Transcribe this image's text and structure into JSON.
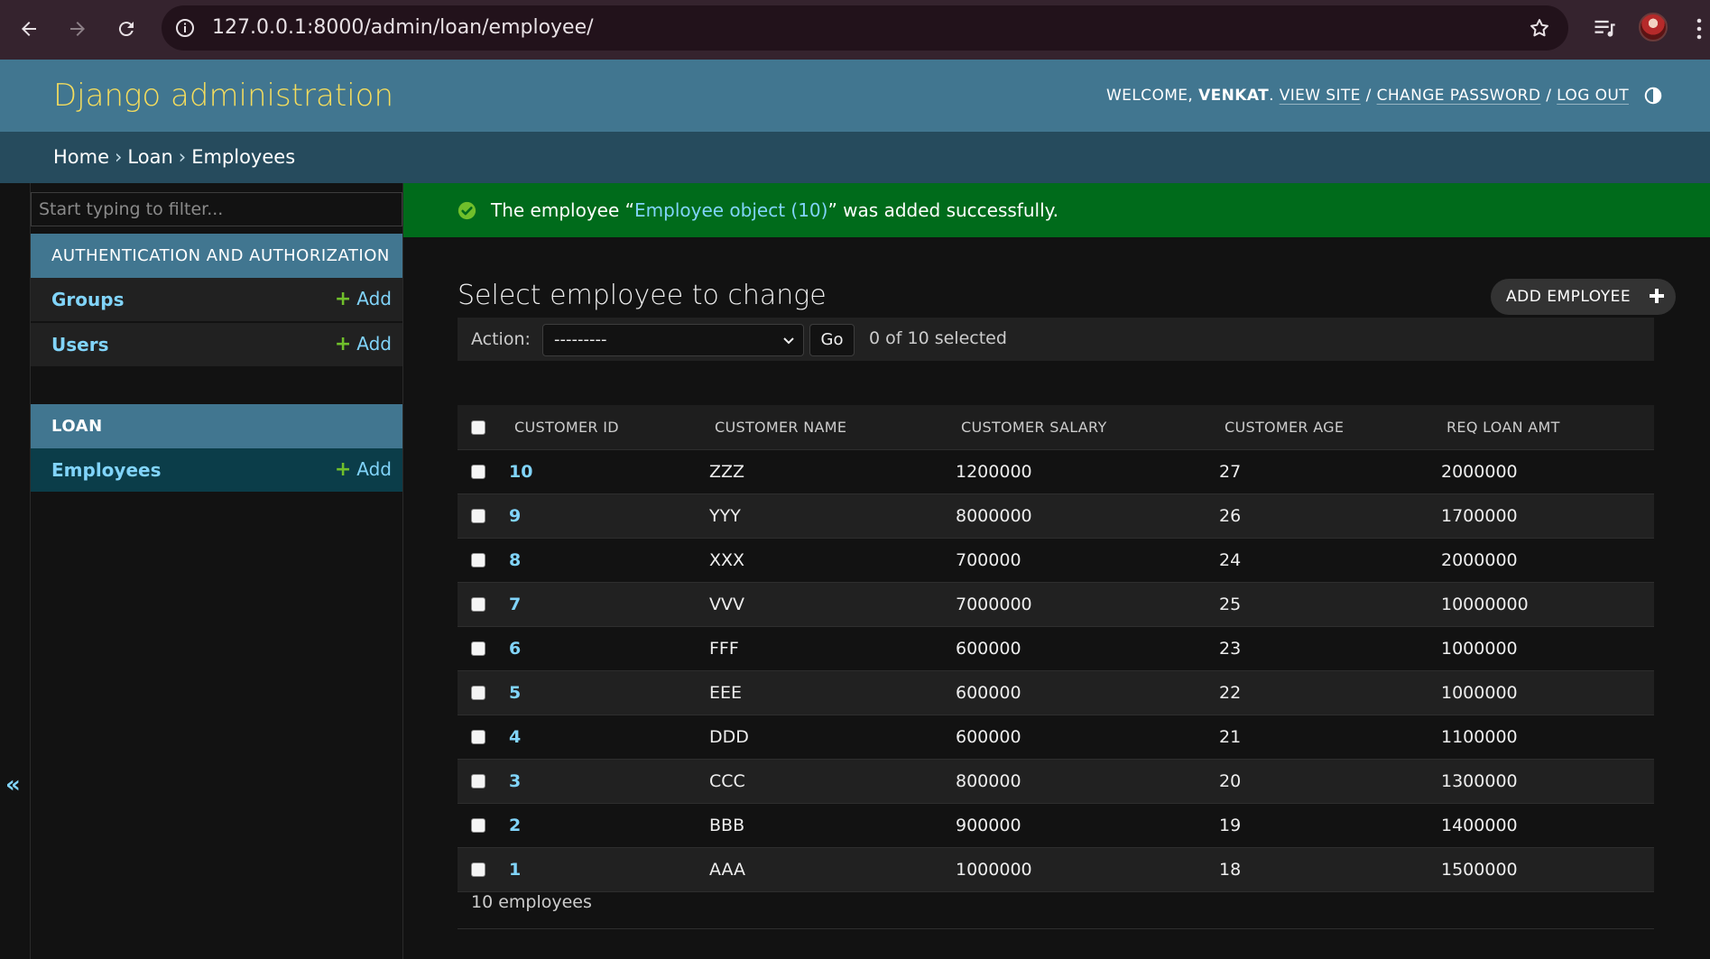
{
  "browser": {
    "url": "127.0.0.1:8000/admin/loan/employee/",
    "chrome_color": "#35232e"
  },
  "header": {
    "site_name": "Django administration",
    "welcome_prefix": "WELCOME,",
    "username": "VENKAT",
    "view_site": "VIEW SITE",
    "change_password": "CHANGE PASSWORD",
    "log_out": "LOG OUT",
    "separator": "/",
    "accent_color": "#f5dd5d"
  },
  "breadcrumbs": {
    "home": "Home",
    "app": "Loan",
    "model": "Employees",
    "separator": "›"
  },
  "sidebar": {
    "filter_placeholder": "Start typing to filter...",
    "collapse_label": "«",
    "modules": [
      {
        "caption": "AUTHENTICATION AND AUTHORIZATION",
        "models": [
          {
            "name": "Groups",
            "add": "Add"
          },
          {
            "name": "Users",
            "add": "Add"
          }
        ]
      },
      {
        "caption": "LOAN",
        "models": [
          {
            "name": "Employees",
            "add": "Add",
            "current": true
          }
        ]
      }
    ]
  },
  "messages": {
    "success_prefix": "The employee “",
    "success_link": "Employee object (10)",
    "success_suffix": "” was added successfully.",
    "success_color": "#006b1b"
  },
  "changelist": {
    "title": "Select employee to change",
    "add_button": "ADD EMPLOYEE",
    "action_label": "Action:",
    "action_selected": "---------",
    "go_button": "Go",
    "selection_counter": "0 of 10 selected",
    "columns": [
      "CUSTOMER ID",
      "CUSTOMER NAME",
      "CUSTOMER SALARY",
      "CUSTOMER AGE",
      "REQ LOAN AMT"
    ],
    "rows": [
      {
        "id": "10",
        "name": "ZZZ",
        "salary": "1200000",
        "age": "27",
        "loan": "2000000"
      },
      {
        "id": "9",
        "name": "YYY",
        "salary": "8000000",
        "age": "26",
        "loan": "1700000"
      },
      {
        "id": "8",
        "name": "XXX",
        "salary": "700000",
        "age": "24",
        "loan": "2000000"
      },
      {
        "id": "7",
        "name": "VVV",
        "salary": "7000000",
        "age": "25",
        "loan": "10000000"
      },
      {
        "id": "6",
        "name": "FFF",
        "salary": "600000",
        "age": "23",
        "loan": "1000000"
      },
      {
        "id": "5",
        "name": "EEE",
        "salary": "600000",
        "age": "22",
        "loan": "1000000"
      },
      {
        "id": "4",
        "name": "DDD",
        "salary": "600000",
        "age": "21",
        "loan": "1100000"
      },
      {
        "id": "3",
        "name": "CCC",
        "salary": "800000",
        "age": "20",
        "loan": "1300000"
      },
      {
        "id": "2",
        "name": "BBB",
        "salary": "900000",
        "age": "19",
        "loan": "1400000"
      },
      {
        "id": "1",
        "name": "AAA",
        "salary": "1000000",
        "age": "18",
        "loan": "1500000"
      }
    ],
    "result_count": "10 employees"
  }
}
